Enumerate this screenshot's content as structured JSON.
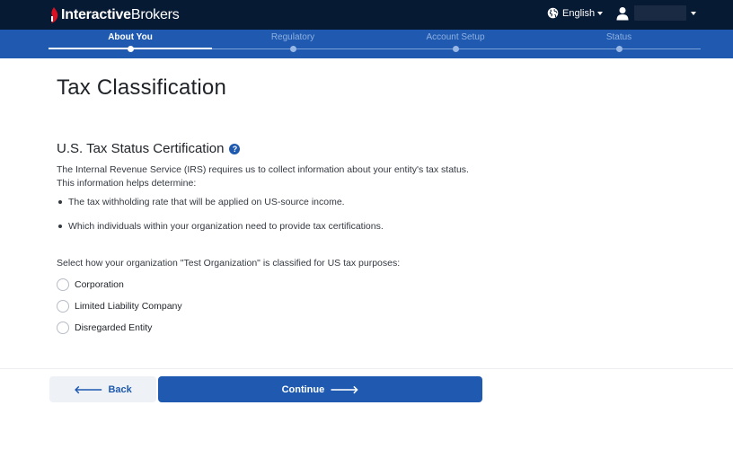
{
  "header": {
    "logo_bold": "Interactive",
    "logo_regular": "Brokers",
    "language": "English",
    "user_icon": "person-icon",
    "globe_icon": "globe-icon"
  },
  "stepper": {
    "steps": [
      {
        "label": "About You",
        "active": true
      },
      {
        "label": "Regulatory",
        "active": false
      },
      {
        "label": "Account Setup",
        "active": false
      },
      {
        "label": "Status",
        "active": false
      }
    ]
  },
  "main": {
    "page_title": "Tax Classification",
    "section_title": "U.S. Tax Status Certification",
    "help_glyph": "?",
    "intro": "The Internal Revenue Service (IRS) requires us to collect information about your entity's tax status. This information helps determine:",
    "bullets": [
      "The tax withholding rate that will be applied on US-source income.",
      "Which individuals within your organization need to provide tax certifications."
    ],
    "prompt": "Select how your organization \"Test Organization\" is classified for US tax purposes:",
    "options": [
      {
        "label": "Corporation",
        "selected": false
      },
      {
        "label": "Limited Liability Company",
        "selected": false
      },
      {
        "label": "Disregarded Entity",
        "selected": false
      }
    ]
  },
  "footer": {
    "back_label": "Back",
    "continue_label": "Continue",
    "back_arrow": "🡐",
    "continue_arrow": "🡒"
  },
  "colors": {
    "topbar": "#071a33",
    "brand_blue": "#1f5ab0",
    "logo_red": "#d81222"
  }
}
